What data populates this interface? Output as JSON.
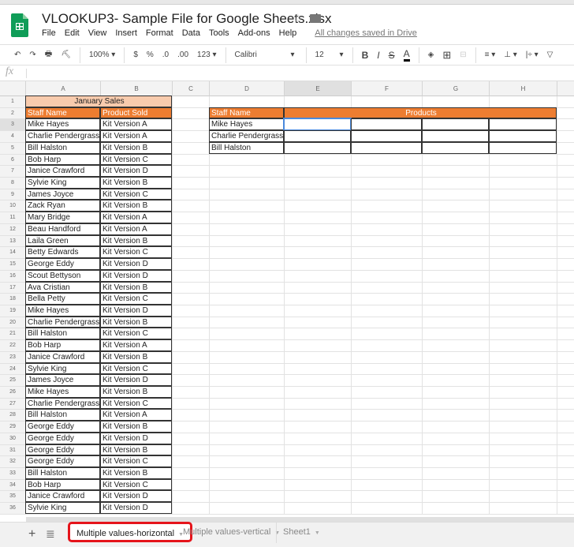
{
  "app": {
    "title": "VLOOKUP3- Sample File for Google Sheets.xlsx",
    "save_status": "All changes saved in Drive"
  },
  "menu": [
    "File",
    "Edit",
    "View",
    "Insert",
    "Format",
    "Data",
    "Tools",
    "Add-ons",
    "Help"
  ],
  "toolbar": {
    "undo": "↶",
    "redo": "↷",
    "print": "🖶",
    "paint": "⛏",
    "zoom": "100% ▾",
    "currency": "$",
    "percent": "%",
    "dec_less": ".0",
    "dec_more": ".00",
    "format": "123 ▾",
    "font": "Calibri",
    "font_size": "12",
    "bold": "B",
    "italic": "I",
    "strike": "S",
    "textcolor": "A",
    "fill": "◈",
    "borders": "⊞",
    "merge": "⊟",
    "align": "≡ ▾",
    "valign": "⊥ ▾",
    "wrap": "|÷ ▾",
    "rotate": "▽"
  },
  "formula_bar": {
    "label": "fx",
    "value": ""
  },
  "columns": [
    "A",
    "B",
    "C",
    "D",
    "E",
    "F",
    "G",
    "H"
  ],
  "selected_cell": "E3",
  "sales": {
    "title": "January Sales",
    "headers": [
      "Staff Name",
      "Product Sold"
    ],
    "rows": [
      [
        "Mike Hayes",
        "Kit Version A"
      ],
      [
        "Charlie Pendergrass",
        "Kit Version A"
      ],
      [
        "Bill Halston",
        "Kit Version B"
      ],
      [
        "Bob Harp",
        "Kit Version C"
      ],
      [
        "Janice Crawford",
        "Kit Version D"
      ],
      [
        "Sylvie King",
        "Kit Version B"
      ],
      [
        "James Joyce",
        "Kit Version C"
      ],
      [
        "Zack Ryan",
        "Kit Version B"
      ],
      [
        "Mary Bridge",
        "Kit Version A"
      ],
      [
        "Beau Handford",
        "Kit Version A"
      ],
      [
        "Laila Green",
        "Kit Version B"
      ],
      [
        "Betty Edwards",
        "Kit Version C"
      ],
      [
        "George Eddy",
        "Kit Version D"
      ],
      [
        "Scout Bettyson",
        "Kit Version D"
      ],
      [
        "Ava Cristian",
        "Kit Version B"
      ],
      [
        "Bella Petty",
        "Kit Version C"
      ],
      [
        "Mike Hayes",
        "Kit Version D"
      ],
      [
        "Charlie Pendergrass",
        "Kit Version B"
      ],
      [
        "Bill Halston",
        "Kit Version C"
      ],
      [
        "Bob Harp",
        "Kit Version A"
      ],
      [
        "Janice Crawford",
        "Kit Version B"
      ],
      [
        "Sylvie King",
        "Kit Version C"
      ],
      [
        "James Joyce",
        "Kit Version D"
      ],
      [
        "Mike Hayes",
        "Kit Version B"
      ],
      [
        "Charlie Pendergrass",
        "Kit Version C"
      ],
      [
        "Bill Halston",
        "Kit Version A"
      ],
      [
        "George Eddy",
        "Kit Version B"
      ],
      [
        "George Eddy",
        "Kit Version D"
      ],
      [
        "George Eddy",
        "Kit Version B"
      ],
      [
        "George Eddy",
        "Kit Version C"
      ],
      [
        "Bill Halston",
        "Kit Version B"
      ],
      [
        "Bob Harp",
        "Kit Version C"
      ],
      [
        "Janice Crawford",
        "Kit Version D"
      ],
      [
        "Sylvie King",
        "Kit Version D"
      ]
    ]
  },
  "lookup": {
    "headers": [
      "Staff Name",
      "Products"
    ],
    "names": [
      "Mike Hayes",
      "Charlie Pendergrass",
      "Bill Halston"
    ]
  },
  "sheet_tabs": [
    {
      "label": "Multiple values-horizontal",
      "active": true
    },
    {
      "label": "Multiple values-vertical",
      "active": false
    },
    {
      "label": "Sheet1",
      "active": false
    }
  ],
  "icons": {
    "add_sheet": "+",
    "all_sheets": "≣"
  },
  "colors": {
    "header_orange": "#ed7d31",
    "title_peach": "#f8cbad",
    "highlight_red": "#e5141b"
  }
}
